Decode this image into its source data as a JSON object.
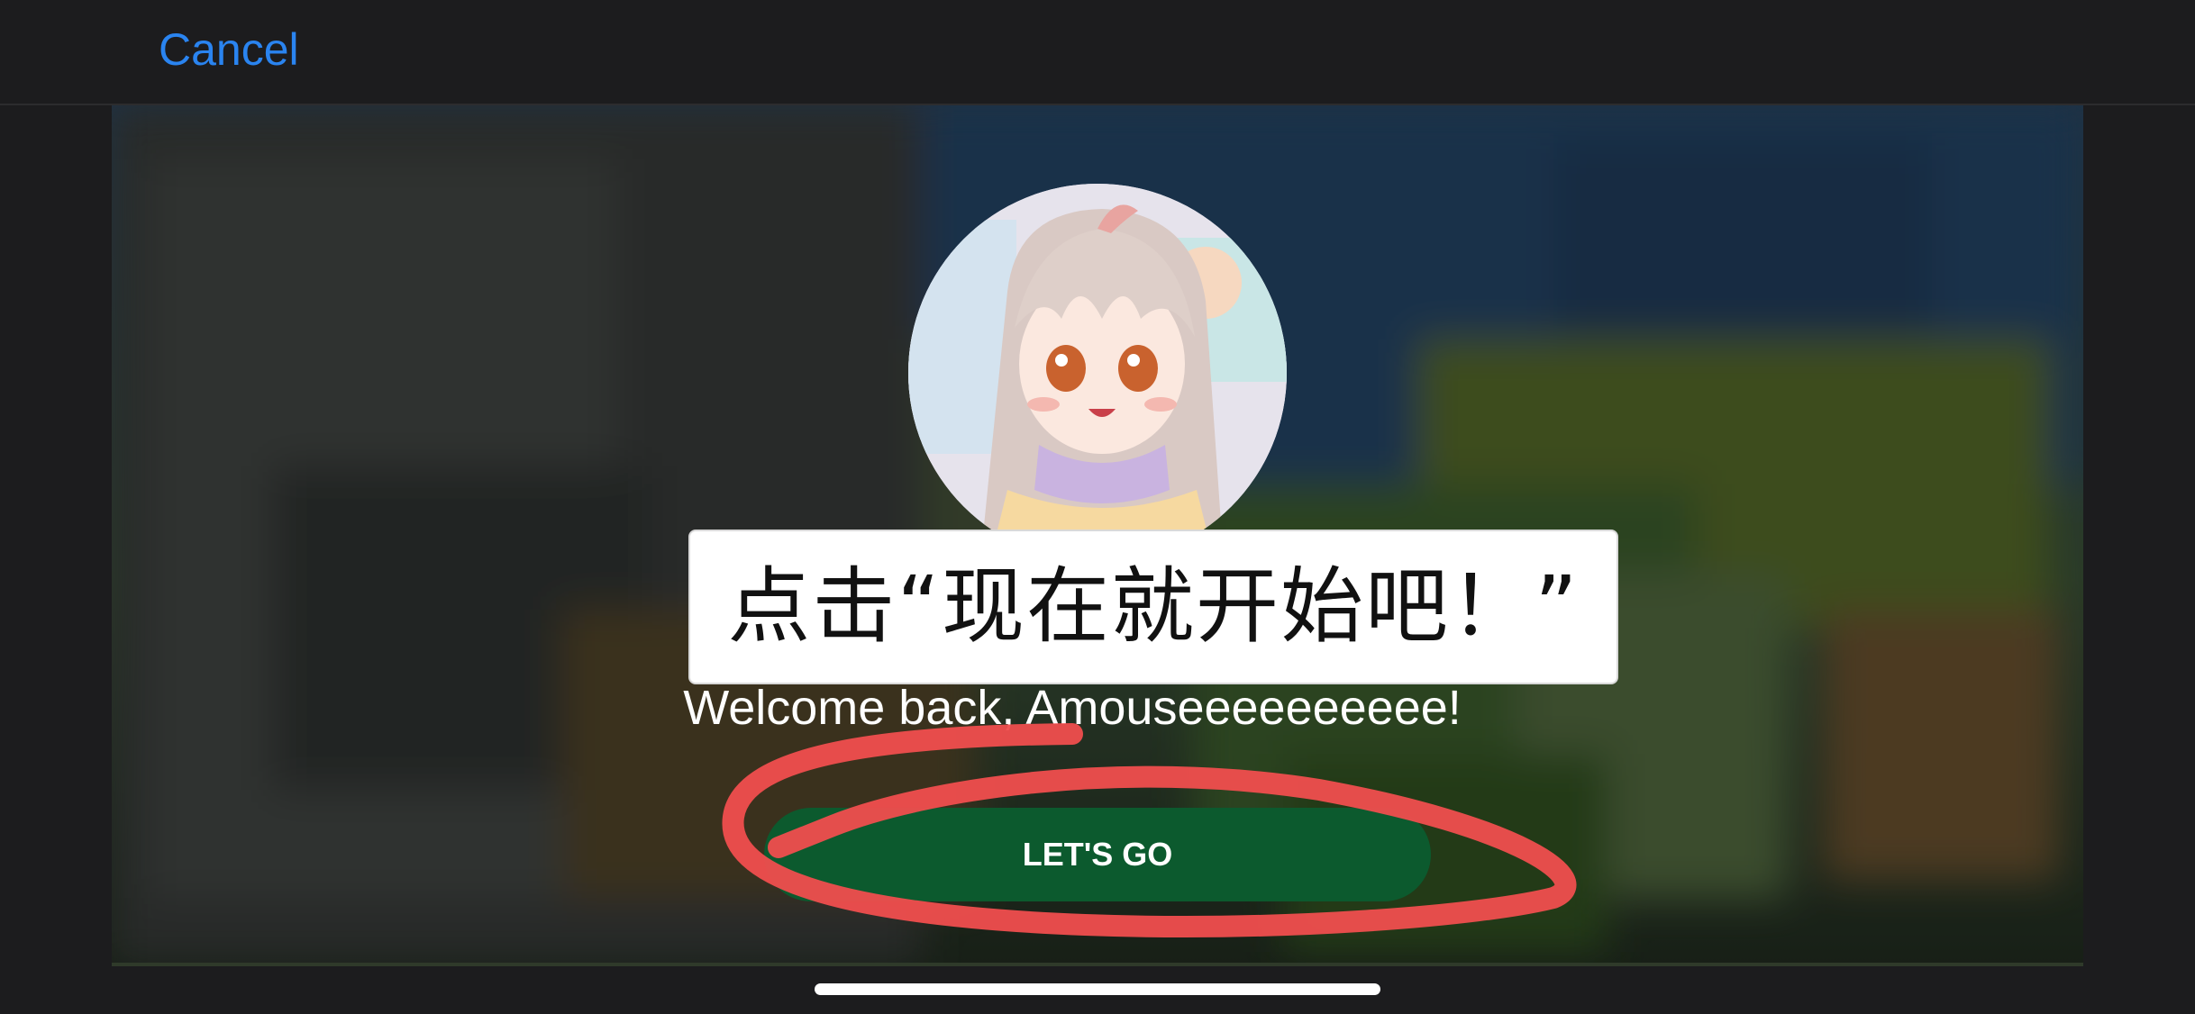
{
  "topbar": {
    "cancel_label": "Cancel"
  },
  "dialog": {
    "caption_text": "点击“现在就开始吧！”",
    "welcome_text": "Welcome back, Amouseeeeeeeeee!",
    "go_button_label": "LET'S GO"
  },
  "icons": {
    "avatar": "anime-avatar-image",
    "annotation": "red-scribble-highlight"
  },
  "colors": {
    "accent": "#2a84f0",
    "button": "#0c5a2e",
    "scribble": "#f04e4e"
  }
}
